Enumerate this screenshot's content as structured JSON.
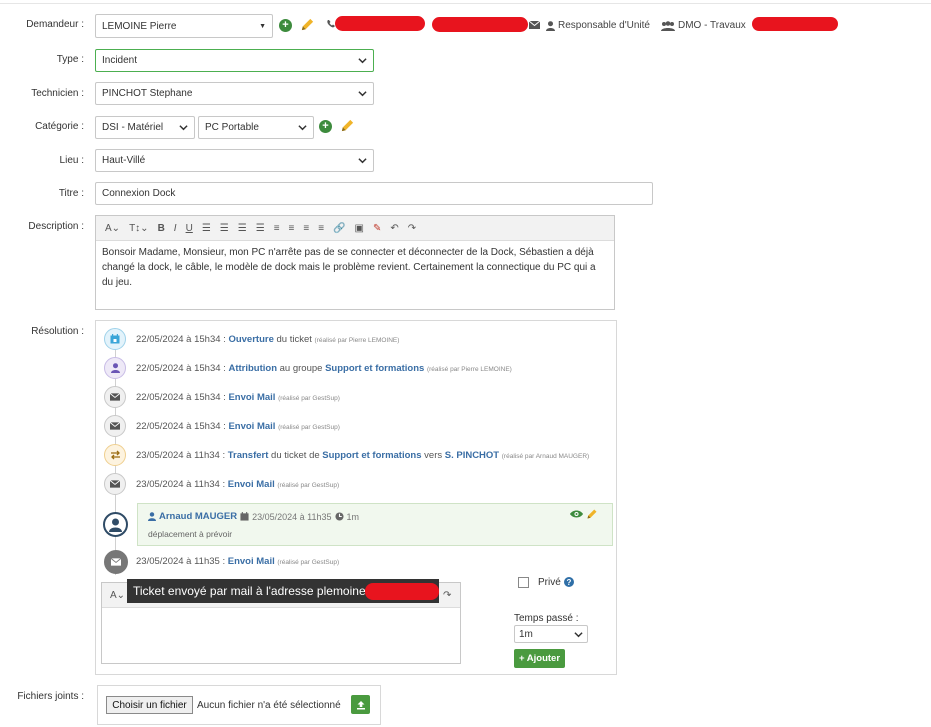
{
  "form": {
    "requester": {
      "label": "Demandeur :",
      "value": "LEMOINE Pierre",
      "role": "Responsable d'Unité",
      "service": "DMO - Travaux"
    },
    "type": {
      "label": "Type :",
      "value": "Incident"
    },
    "technician": {
      "label": "Technicien :",
      "value": "PINCHOT Stephane"
    },
    "category": {
      "label": "Catégorie :",
      "value": "DSI - Matériel",
      "subvalue": "PC Portable"
    },
    "place": {
      "label": "Lieu :",
      "value": "Haut-Villé"
    },
    "title": {
      "label": "Titre :",
      "value": "Connexion Dock"
    },
    "description": {
      "label": "Description :",
      "text": "Bonsoir Madame, Monsieur, mon PC n'arrête pas de se connecter et déconnecter de la Dock, Sébastien a déjà changé la dock, le câble, le modèle de dock mais le problème revient. Certainement la connectique du PC qui a du jeu."
    },
    "resolution": {
      "label": "Résolution :"
    },
    "attachments": {
      "label": "Fichiers joints :",
      "button": "Choisir un fichier",
      "none": "Aucun fichier n'a été sélectionné"
    }
  },
  "timeline": {
    "events": [
      {
        "date": "22/05/2024 à 15h34 :",
        "action": "Ouverture",
        "rest": " du ticket",
        "by": "(réalisé par Pierre LEMOINE)"
      },
      {
        "date": "22/05/2024 à 15h34 :",
        "action": "Attribution",
        "rest": " au groupe ",
        "target": "Support et formations",
        "by": "(réalisé par Pierre LEMOINE)"
      },
      {
        "date": "22/05/2024 à 15h34 :",
        "action": "Envoi Mail",
        "by": "(réalisé par GestSup)"
      },
      {
        "date": "22/05/2024 à 15h34 :",
        "action": "Envoi Mail",
        "by": "(réalisé par GestSup)"
      },
      {
        "date": "23/05/2024 à 11h34 :",
        "action": "Transfert",
        "rest": " du ticket de ",
        "target": "Support et formations",
        "rest2": " vers ",
        "target2": "S. PINCHOT",
        "by": "(réalisé par Arnaud MAUGER)"
      },
      {
        "date": "23/05/2024 à 11h34 :",
        "action": "Envoi Mail",
        "by": "(réalisé par GestSup)"
      }
    ],
    "comment": {
      "author": "Arnaud MAUGER",
      "date": "23/05/2024 à 11h35",
      "duration": "1m",
      "text": "déplacement à prévoir"
    },
    "last": {
      "date": "23/05/2024 à 11h35 :",
      "action": "Envoi Mail",
      "by": "(réalisé par GestSup)"
    }
  },
  "tooltip": {
    "text": "Ticket envoyé par mail à l'adresse plemoine"
  },
  "side": {
    "private": "Privé",
    "time_label": "Temps passé :",
    "time_value": "1m",
    "add": "+ Ajouter"
  },
  "colors": {
    "green": "#3d8b3d",
    "link": "#3a6ea5",
    "redact": "#e8141e"
  }
}
